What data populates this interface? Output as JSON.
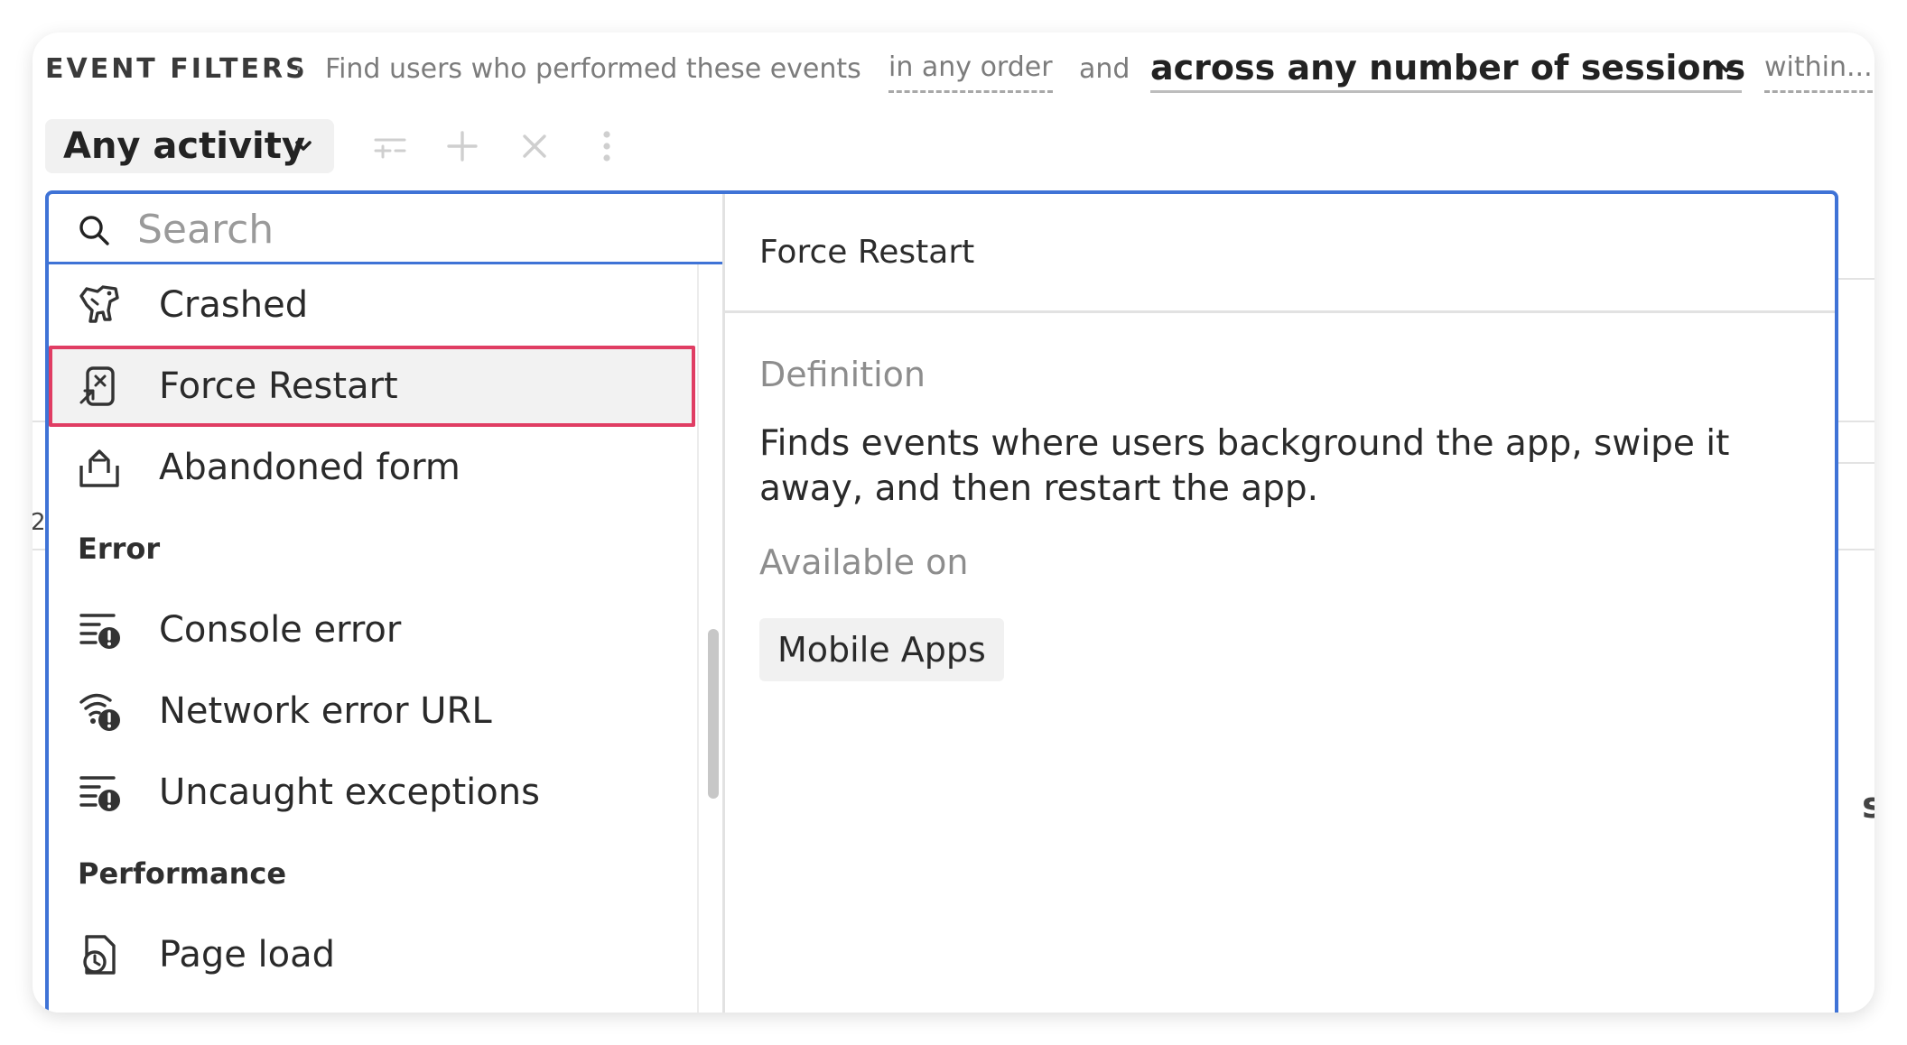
{
  "header": {
    "title": "EVENT FILTERS",
    "separator": "·",
    "description": "Find users who performed these events",
    "order_option": "in any order",
    "connector": "and",
    "sessions_option": "across any number of sessions",
    "within_option": "within..."
  },
  "toolbar": {
    "activity_label": "Any activity"
  },
  "search": {
    "placeholder": "Search",
    "value": ""
  },
  "list": {
    "items_top": [
      {
        "label": "Crashed",
        "icon": "dinosaur-icon"
      },
      {
        "label": "Force Restart",
        "icon": "force-restart-icon",
        "selected": true
      },
      {
        "label": "Abandoned form",
        "icon": "abandoned-form-icon"
      }
    ],
    "group_error": "Error",
    "items_error": [
      {
        "label": "Console error",
        "icon": "console-error-icon"
      },
      {
        "label": "Network error URL",
        "icon": "network-error-icon"
      },
      {
        "label": "Uncaught exceptions",
        "icon": "uncaught-exception-icon"
      }
    ],
    "group_performance": "Performance",
    "items_performance": [
      {
        "label": "Page load",
        "icon": "page-load-icon"
      }
    ]
  },
  "detail": {
    "title": "Force Restart",
    "definition_label": "Definition",
    "definition_text": "Finds events where users background the app, swipe it away, and then restart the app.",
    "available_label": "Available on",
    "platform": "Mobile Apps"
  },
  "background": {
    "fragment_left": "2",
    "fragment_right": "s"
  },
  "colors": {
    "focus_border": "#3f73d6",
    "selection_border": "#e03d63",
    "selected_bg": "#f2f2f2"
  }
}
